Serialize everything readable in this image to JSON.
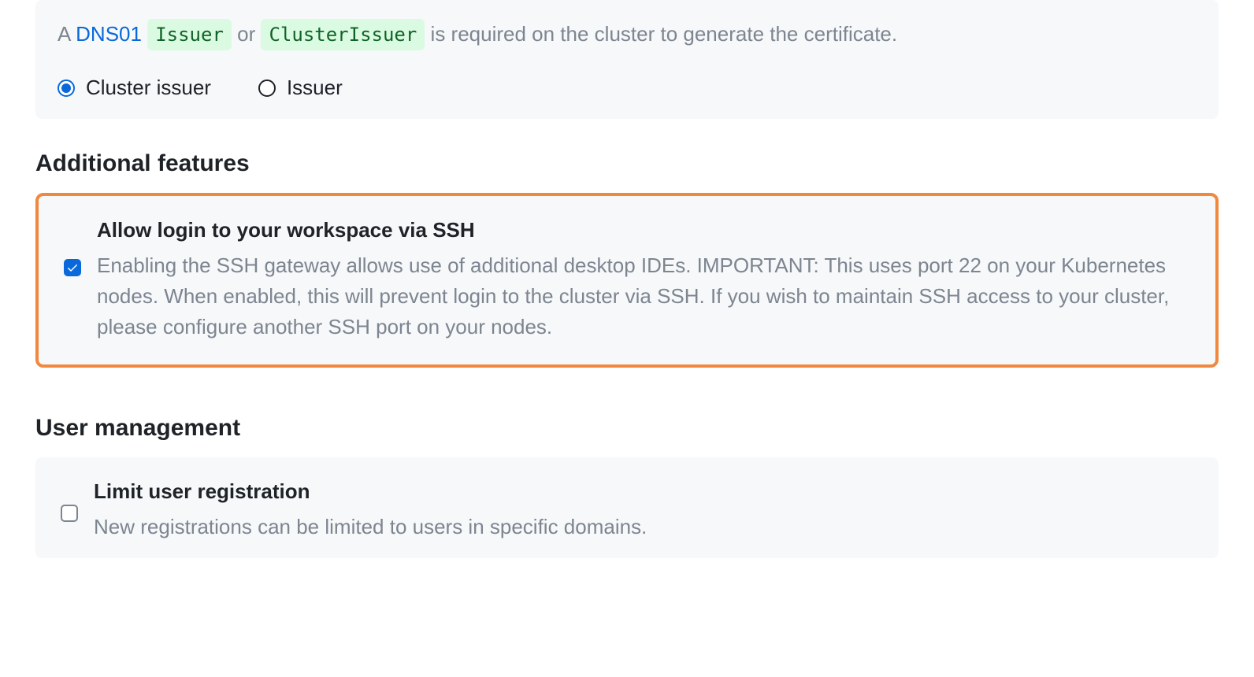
{
  "dns": {
    "prefix": "A ",
    "link_text": "DNS01",
    "chip1": "Issuer",
    "middle": " or ",
    "chip2": "ClusterIssuer",
    "suffix": " is required on the cluster to generate the certificate.",
    "radio_cluster": "Cluster issuer",
    "radio_issuer": "Issuer"
  },
  "additional": {
    "heading": "Additional features",
    "ssh_title": "Allow login to your workspace via SSH",
    "ssh_desc": "Enabling the SSH gateway allows use of additional desktop IDEs. IMPORTANT: This uses port 22 on your Kubernetes nodes. When enabled, this will prevent login to the cluster via SSH. If you wish to maintain SSH access to your cluster, please configure another SSH port on your nodes."
  },
  "user_mgmt": {
    "heading": "User management",
    "limit_title": "Limit user registration",
    "limit_desc": "New registrations can be limited to users in specific domains."
  }
}
